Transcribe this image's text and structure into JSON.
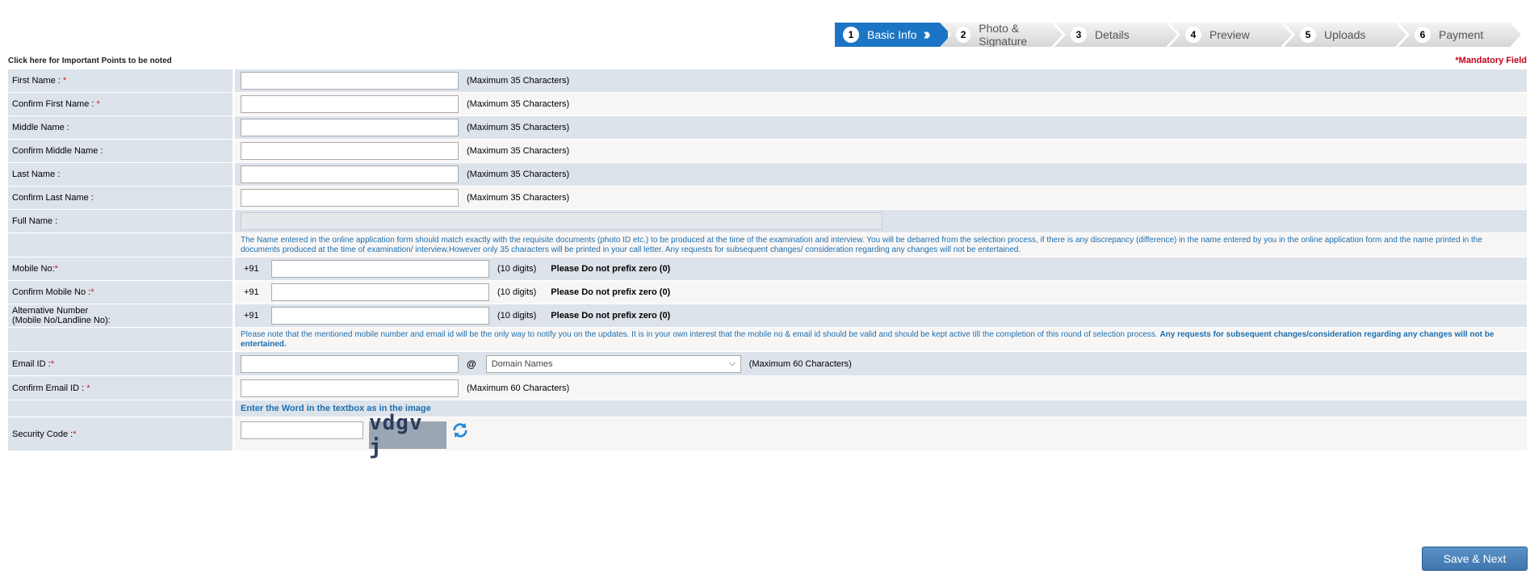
{
  "stepper": [
    {
      "num": "1",
      "label": "Basic Info",
      "active": true
    },
    {
      "num": "2",
      "label": "Photo & Signature"
    },
    {
      "num": "3",
      "label": "Details"
    },
    {
      "num": "4",
      "label": "Preview"
    },
    {
      "num": "5",
      "label": "Uploads"
    },
    {
      "num": "6",
      "label": "Payment"
    }
  ],
  "important_link": "Click here for Important Points to be noted",
  "mandatory_note": "*Mandatory Field",
  "fields": {
    "first_name": {
      "label": "First Name :",
      "req": "*",
      "hint": "(Maximum 35 Characters)",
      "value": ""
    },
    "confirm_first_name": {
      "label": "Confirm First Name :",
      "req": "*",
      "hint": "(Maximum 35 Characters)",
      "value": ""
    },
    "middle_name": {
      "label": "Middle Name :",
      "hint": "(Maximum 35 Characters)",
      "value": ""
    },
    "confirm_middle_name": {
      "label": "Confirm Middle Name :",
      "hint": "(Maximum 35 Characters)",
      "value": ""
    },
    "last_name": {
      "label": "Last Name :",
      "hint": "(Maximum 35 Characters)",
      "value": ""
    },
    "confirm_last_name": {
      "label": "Confirm Last Name :",
      "hint": "(Maximum 35 Characters)",
      "value": ""
    },
    "full_name": {
      "label": "Full Name :",
      "value": ""
    },
    "mobile": {
      "label": "Mobile No:",
      "req": "*",
      "prefix": "+91",
      "hint": "(10 digits)",
      "note": "Please Do not prefix zero (0)",
      "value": ""
    },
    "confirm_mobile": {
      "label": "Confirm Mobile No :",
      "req": "*",
      "prefix": "+91",
      "hint": "(10 digits)",
      "note": "Please Do not prefix zero (0)",
      "value": ""
    },
    "alt_number": {
      "label_line1": "Alternative Number",
      "label_line2": "(Mobile No/Landline No):",
      "prefix": "+91",
      "hint": "(10 digits)",
      "note": "Please Do not prefix zero (0)",
      "value": ""
    },
    "email": {
      "label": "Email ID :",
      "req": "*",
      "at": "@",
      "domain_selected": "Domain Names",
      "hint": "(Maximum 60 Characters)",
      "value": ""
    },
    "confirm_email": {
      "label": "Confirm Email ID :",
      "req": "*",
      "hint": "(Maximum 60 Characters)",
      "value": ""
    },
    "security_code": {
      "label": "Security Code :",
      "req": "*",
      "captcha_text": "vdgv j",
      "value": ""
    }
  },
  "name_info": "The Name entered in the online application form should match exactly with the requisite documents (photo ID etc.) to be produced at the time of the examination and interview. You will be debarred from the selection process, if there is any discrepancy (difference) in the name entered by you in the online application form and the name printed in the documents produced at the time of examination/ interview.However only 35 characters will be printed in your call letter. Any requests for subsequent changes/ consideration regarding any changes will not be entertained.",
  "contact_info_plain": "Please note that the mentioned mobile number and email id will be the only way to notify you on the updates. It is in your own interest that the mobile no & email id should be valid and should be kept active till the completion of this round of selection process. ",
  "contact_info_bold": "Any requests for subsequent changes/consideration regarding any changes will not be entertained.",
  "captcha_hint": "Enter the Word in the textbox as in the image",
  "save_next": "Save & Next",
  "icons": {
    "refresh": "refresh-icon",
    "dropdown": "chevron-down-icon"
  }
}
